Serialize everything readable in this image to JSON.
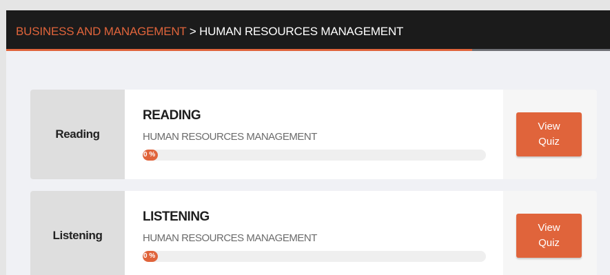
{
  "breadcrumb": {
    "parent": "BUSINESS AND MANAGEMENT",
    "separator": ">",
    "current": "HUMAN RESOURCES MANAGEMENT"
  },
  "colors": {
    "accent": "#e0643b",
    "header_bg": "#1b1b1b"
  },
  "cards": [
    {
      "label": "Reading",
      "title": "READING",
      "subtitle": "HUMAN RESOURCES MANAGEMENT",
      "progress_percent": 0,
      "progress_text": "0 %",
      "button_line1": "View",
      "button_line2": "Quiz"
    },
    {
      "label": "Listening",
      "title": "LISTENING",
      "subtitle": "HUMAN RESOURCES MANAGEMENT",
      "progress_percent": 0,
      "progress_text": "0 %",
      "button_line1": "View",
      "button_line2": "Quiz"
    }
  ]
}
